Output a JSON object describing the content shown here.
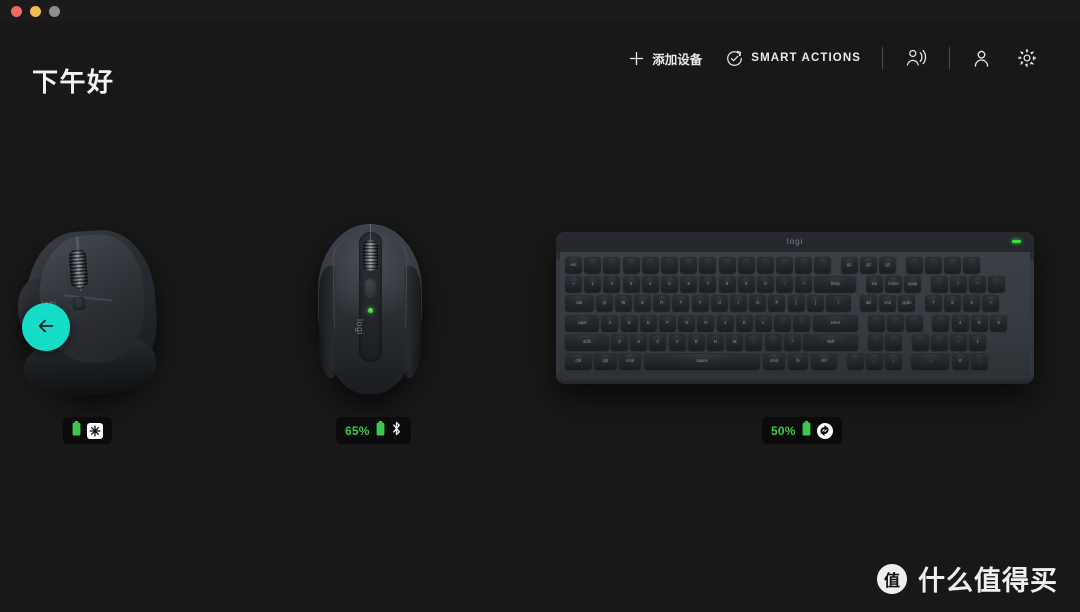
{
  "window": {
    "traffic_lights": [
      {
        "name": "close",
        "color": "#ec6a5f"
      },
      {
        "name": "minimize",
        "color": "#f4bd4f"
      },
      {
        "name": "maximize",
        "color": "#8e8e8e"
      }
    ],
    "background": "#181818",
    "titlebar_background": "#1b1b1b"
  },
  "header": {
    "greeting": "下午好",
    "toolbar": {
      "add_device": {
        "label": "添加设备",
        "icon": "plus-icon"
      },
      "smart_actions": {
        "label": "SMART ACTIONS",
        "icon": "check-circle-arrow-icon"
      },
      "voice": {
        "icon": "person-voice-icon"
      },
      "account": {
        "icon": "person-icon"
      },
      "settings": {
        "icon": "gear-icon"
      }
    }
  },
  "back_button": {
    "icon": "arrow-left-icon",
    "color": "#14dcc6"
  },
  "devices": [
    {
      "id": "mx-master",
      "type": "mouse",
      "brand_mark": "logi",
      "battery": {
        "percent_label": "",
        "show_percent": false,
        "icon": "battery-icon",
        "color": "#3cc84a"
      },
      "connection": {
        "icon": "bolt-receiver-icon",
        "style": "square"
      }
    },
    {
      "id": "mx-anywhere",
      "type": "mouse",
      "brand_mark": "logi",
      "battery": {
        "percent_label": "65%",
        "show_percent": true,
        "icon": "battery-icon",
        "color": "#3cc84a"
      },
      "connection": {
        "icon": "bluetooth-icon",
        "style": "plain"
      }
    },
    {
      "id": "mx-keys",
      "type": "keyboard",
      "brand_mark": "logi",
      "battery": {
        "percent_label": "50%",
        "show_percent": true,
        "icon": "battery-icon",
        "color": "#3cc84a"
      },
      "connection": {
        "icon": "flow-sync-icon",
        "style": "round"
      }
    }
  ],
  "keyboard_layout": {
    "rows": [
      [
        "esc",
        "",
        "",
        "",
        "",
        "",
        "",
        "",
        "",
        "",
        "",
        "",
        "",
        "",
        "g1",
        "g2",
        "g3",
        "",
        "",
        "",
        ""
      ],
      [
        "~",
        "1",
        "2",
        "3",
        "4",
        "5",
        "6",
        "7",
        "8",
        "9",
        "0",
        "-",
        "+",
        "bksp",
        "ins",
        "home",
        "pgup",
        "",
        "/",
        "*",
        "-"
      ],
      [
        "tab",
        "Q",
        "W",
        "E",
        "R",
        "T",
        "Y",
        "U",
        "I",
        "O",
        "P",
        "[",
        "]",
        "\\",
        "del",
        "end",
        "pgdn",
        "7",
        "8",
        "9",
        "+"
      ],
      [
        "caps",
        "A",
        "S",
        "D",
        "F",
        "G",
        "H",
        "J",
        "K",
        "L",
        ";",
        "'",
        "enter",
        "",
        "",
        "",
        "",
        "4",
        "5",
        "6",
        ""
      ],
      [
        "shift",
        "Z",
        "X",
        "C",
        "V",
        "B",
        "N",
        "M",
        ",",
        ".",
        "/",
        "shift",
        "",
        "",
        "",
        "",
        "↑",
        "1",
        "2",
        "3",
        "ent"
      ],
      [
        "ctrl",
        "opt",
        "cmd",
        "space",
        "cmd",
        "fn",
        "ctrl",
        "",
        "←",
        "↓",
        "→",
        "0",
        ".",
        ""
      ]
    ]
  },
  "watermark": {
    "logo_char": "值",
    "text": "什么值得买"
  }
}
